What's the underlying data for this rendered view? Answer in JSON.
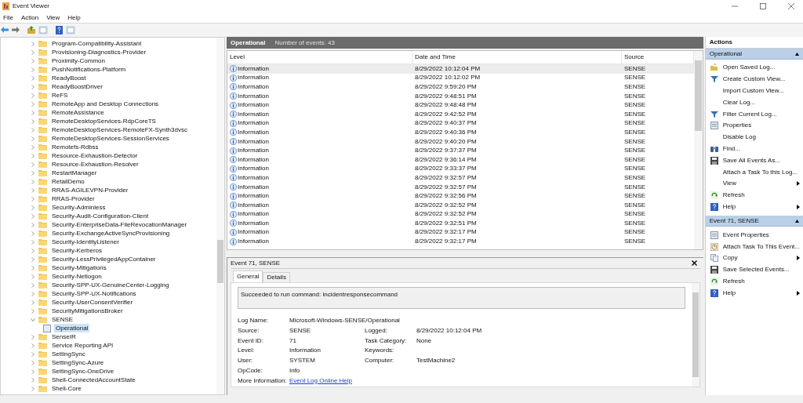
{
  "window": {
    "title": "Event Viewer"
  },
  "menu": [
    "File",
    "Action",
    "View",
    "Help"
  ],
  "tree": [
    {
      "label": "Program-Compatibility-Assistant",
      "expanded": false
    },
    {
      "label": "Provisioning-Diagnostics-Provider",
      "expanded": false
    },
    {
      "label": "Proximity-Common",
      "expanded": false
    },
    {
      "label": "PushNotifications-Platform",
      "expanded": false
    },
    {
      "label": "ReadyBoost",
      "expanded": false
    },
    {
      "label": "ReadyBoostDriver",
      "expanded": false
    },
    {
      "label": "ReFS",
      "expanded": false
    },
    {
      "label": "RemoteApp and Desktop Connections",
      "expanded": false
    },
    {
      "label": "RemoteAssistance",
      "expanded": false
    },
    {
      "label": "RemoteDesktopServices-RdpCoreTS",
      "expanded": false
    },
    {
      "label": "RemoteDesktopServices-RemoteFX-Synth3dvsc",
      "expanded": false
    },
    {
      "label": "RemoteDesktopServices-SessionServices",
      "expanded": false
    },
    {
      "label": "Remotefs-Rdbss",
      "expanded": false
    },
    {
      "label": "Resource-Exhaustion-Detector",
      "expanded": false
    },
    {
      "label": "Resource-Exhaustion-Resolver",
      "expanded": false
    },
    {
      "label": "RestartManager",
      "expanded": false
    },
    {
      "label": "RetailDemo",
      "expanded": false
    },
    {
      "label": "RRAS-AGILEVPN-Provider",
      "expanded": false
    },
    {
      "label": "RRAS-Provider",
      "expanded": false
    },
    {
      "label": "Security-Adminless",
      "expanded": false
    },
    {
      "label": "Security-Audit-Configuration-Client",
      "expanded": false
    },
    {
      "label": "Security-EnterpriseData-FileRevocationManager",
      "expanded": false
    },
    {
      "label": "Security-ExchangeActiveSyncProvisioning",
      "expanded": false
    },
    {
      "label": "Security-IdentityListener",
      "expanded": false
    },
    {
      "label": "Security-Kerberos",
      "expanded": false
    },
    {
      "label": "Security-LessPrivilegedAppContainer",
      "expanded": false
    },
    {
      "label": "Security-Mitigations",
      "expanded": false
    },
    {
      "label": "Security-Netlogon",
      "expanded": false
    },
    {
      "label": "Security-SPP-UX-GenuineCenter-Logging",
      "expanded": false
    },
    {
      "label": "Security-SPP-UX-Notifications",
      "expanded": false
    },
    {
      "label": "Security-UserConsentVerifier",
      "expanded": false
    },
    {
      "label": "SecurityMitigationsBroker",
      "expanded": false
    },
    {
      "label": "SENSE",
      "expanded": true,
      "children": [
        {
          "label": "Operational",
          "selected": true
        }
      ]
    },
    {
      "label": "SenseIR",
      "expanded": false
    },
    {
      "label": "Service Reporting API",
      "expanded": false
    },
    {
      "label": "SettingSync",
      "expanded": false
    },
    {
      "label": "SettingSync-Azure",
      "expanded": false
    },
    {
      "label": "SettingSync-OneDrive",
      "expanded": false
    },
    {
      "label": "Shell-ConnectedAccountState",
      "expanded": false
    },
    {
      "label": "Shell-Core",
      "expanded": false
    }
  ],
  "log_header": {
    "name": "Operational",
    "count": "Number of events: 43"
  },
  "table": {
    "columns": [
      "Level",
      "Date and Time",
      "Source"
    ],
    "rows": [
      {
        "level": "Information",
        "date_time": "8/29/2022 10:12:04 PM",
        "source": "SENSE",
        "selected": true
      },
      {
        "level": "Information",
        "date_time": "8/29/2022 10:12:02 PM",
        "source": "SENSE",
        "selected": false
      },
      {
        "level": "Information",
        "date_time": "8/29/2022 9:59:20 PM",
        "source": "SENSE",
        "selected": false
      },
      {
        "level": "Information",
        "date_time": "8/29/2022 9:48:51 PM",
        "source": "SENSE",
        "selected": false
      },
      {
        "level": "Information",
        "date_time": "8/29/2022 9:48:48 PM",
        "source": "SENSE",
        "selected": false
      },
      {
        "level": "Information",
        "date_time": "8/29/2022 9:42:52 PM",
        "source": "SENSE",
        "selected": false
      },
      {
        "level": "Information",
        "date_time": "8/29/2022 9:40:37 PM",
        "source": "SENSE",
        "selected": false
      },
      {
        "level": "Information",
        "date_time": "8/29/2022 9:40:36 PM",
        "source": "SENSE",
        "selected": false
      },
      {
        "level": "Information",
        "date_time": "8/29/2022 9:40:20 PM",
        "source": "SENSE",
        "selected": false
      },
      {
        "level": "Information",
        "date_time": "8/29/2022 9:37:37 PM",
        "source": "SENSE",
        "selected": false
      },
      {
        "level": "Information",
        "date_time": "8/29/2022 9:36:14 PM",
        "source": "SENSE",
        "selected": false
      },
      {
        "level": "Information",
        "date_time": "8/29/2022 9:33:37 PM",
        "source": "SENSE",
        "selected": false
      },
      {
        "level": "Information",
        "date_time": "8/29/2022 9:32:57 PM",
        "source": "SENSE",
        "selected": false
      },
      {
        "level": "Information",
        "date_time": "8/29/2022 9:32:57 PM",
        "source": "SENSE",
        "selected": false
      },
      {
        "level": "Information",
        "date_time": "8/29/2022 9:32:56 PM",
        "source": "SENSE",
        "selected": false
      },
      {
        "level": "Information",
        "date_time": "8/29/2022 9:32:52 PM",
        "source": "SENSE",
        "selected": false
      },
      {
        "level": "Information",
        "date_time": "8/29/2022 9:32:52 PM",
        "source": "SENSE",
        "selected": false
      },
      {
        "level": "Information",
        "date_time": "8/29/2022 9:32:51 PM",
        "source": "SENSE",
        "selected": false
      },
      {
        "level": "Information",
        "date_time": "8/29/2022 9:32:17 PM",
        "source": "SENSE",
        "selected": false
      },
      {
        "level": "Information",
        "date_time": "8/29/2022 9:32:17 PM",
        "source": "SENSE",
        "selected": false
      }
    ]
  },
  "event": {
    "title": "Event 71, SENSE",
    "tabs": [
      {
        "label": "General",
        "selected": true
      },
      {
        "label": "Details",
        "selected": false
      }
    ],
    "message": "Succeeded to run command: incidentresponsecommand",
    "rows": [
      [
        {
          "label": "Log Name:",
          "value": "Microsoft-Windows-SENSE/Operational"
        }
      ],
      [
        {
          "label": "Source:",
          "value": "SENSE"
        },
        {
          "label": "Logged:",
          "value": "8/29/2022 10:12:04 PM"
        }
      ],
      [
        {
          "label": "Event ID:",
          "value": "71"
        },
        {
          "label": "Task Category:",
          "value": "None"
        }
      ],
      [
        {
          "label": "Level:",
          "value": "Information"
        },
        {
          "label": "Keywords:"
        }
      ],
      [
        {
          "label": "User:",
          "value": "SYSTEM"
        },
        {
          "label": "Computer:",
          "value": "TestMachine2"
        }
      ],
      [
        {
          "label": "OpCode:",
          "value": "Info"
        }
      ],
      [
        {
          "label": "More Information:",
          "value": "Event Log Online Help",
          "kind": "link"
        }
      ]
    ]
  },
  "actions": {
    "title": "Actions",
    "sections": [
      {
        "title": "Operational",
        "expanded": true,
        "items": [
          {
            "label": "Open Saved Log...",
            "kind": "folder",
            "submenu": false
          },
          {
            "label": "Create Custom View...",
            "kind": "funnel",
            "submenu": false
          },
          {
            "label": "Import Custom View...",
            "kind": "none",
            "submenu": false
          },
          {
            "label": "Clear Log...",
            "kind": "none",
            "submenu": false
          },
          {
            "label": "Filter Current Log...",
            "kind": "funnel",
            "submenu": false
          },
          {
            "label": "Properties",
            "kind": "sheet",
            "submenu": false
          },
          {
            "label": "Disable Log",
            "kind": "none",
            "submenu": false
          },
          {
            "label": "Find...",
            "kind": "binoculars",
            "submenu": false
          },
          {
            "label": "Save All Events As...",
            "kind": "disk",
            "submenu": false
          },
          {
            "label": "Attach a Task To this Log...",
            "kind": "none",
            "submenu": false
          },
          {
            "label": "View",
            "kind": "none",
            "submenu": true
          },
          {
            "label": "Refresh",
            "kind": "refresh",
            "submenu": false
          },
          {
            "label": "Help",
            "kind": "help",
            "submenu": true
          }
        ]
      },
      {
        "title": "Event 71, SENSE",
        "expanded": true,
        "items": [
          {
            "label": "Event Properties",
            "kind": "sheet",
            "submenu": false
          },
          {
            "label": "Attach Task To This Event...",
            "kind": "task",
            "submenu": false
          },
          {
            "label": "Copy",
            "kind": "copy",
            "submenu": true
          },
          {
            "label": "Save Selected Events...",
            "kind": "disk",
            "submenu": false
          },
          {
            "label": "Refresh",
            "kind": "refresh",
            "submenu": false
          },
          {
            "label": "Help",
            "kind": "help",
            "submenu": true
          }
        ]
      }
    ]
  }
}
